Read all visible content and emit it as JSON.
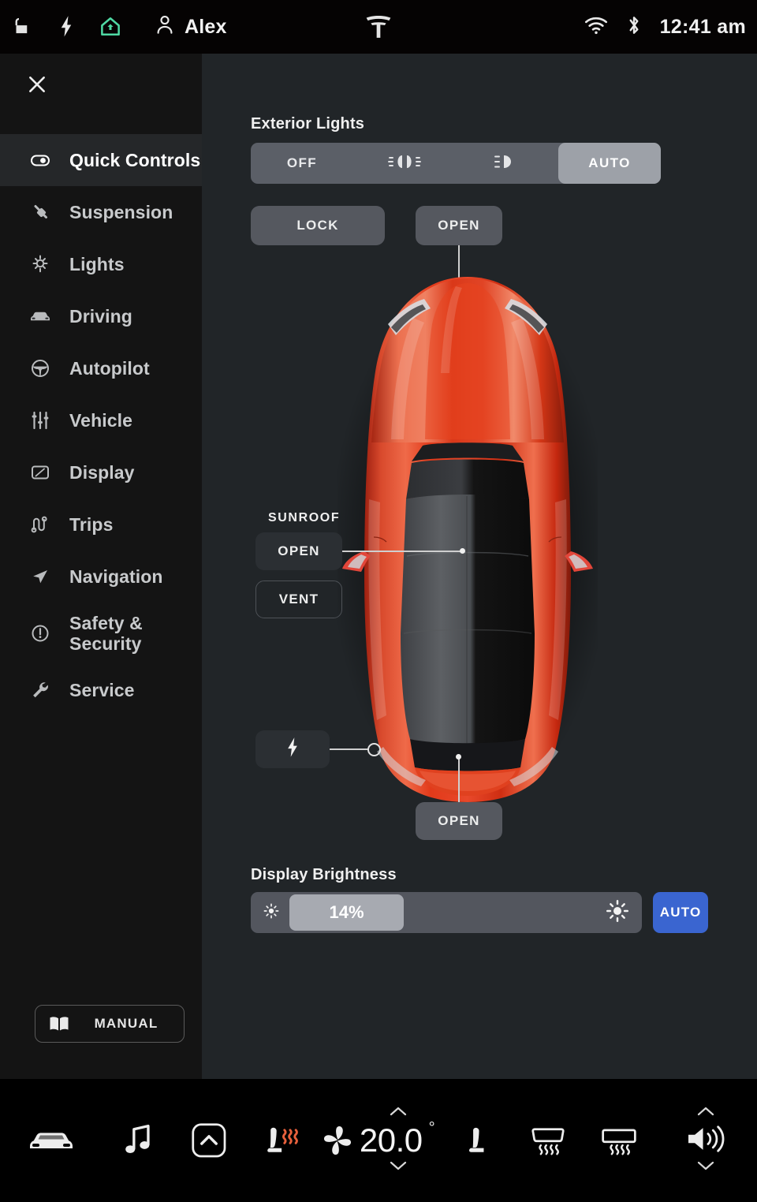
{
  "statusbar": {
    "icons": [
      "unlock-icon",
      "charge-bolt-icon",
      "home-icon",
      "person-icon"
    ],
    "profile_name": "Alex",
    "brand_logo": "tesla-logo-icon",
    "wifi": "wifi-icon",
    "bluetooth": "bluetooth-icon",
    "time": "12:41 am"
  },
  "sidebar": {
    "close": "close-icon",
    "items": [
      {
        "label": "Quick Controls",
        "icon": "toggle-icon",
        "active": true
      },
      {
        "label": "Suspension",
        "icon": "shock-absorber-icon",
        "active": false
      },
      {
        "label": "Lights",
        "icon": "sun-rays-icon",
        "active": false
      },
      {
        "label": "Driving",
        "icon": "car-front-icon",
        "active": false
      },
      {
        "label": "Autopilot",
        "icon": "steering-wheel-icon",
        "active": false
      },
      {
        "label": "Vehicle",
        "icon": "sliders-icon",
        "active": false
      },
      {
        "label": "Display",
        "icon": "screen-icon",
        "active": false
      },
      {
        "label": "Trips",
        "icon": "trip-meter-icon",
        "active": false
      },
      {
        "label": "Navigation",
        "icon": "navigation-arrow-icon",
        "active": false
      },
      {
        "label": "Safety & Security",
        "icon": "alert-circle-icon",
        "active": false
      },
      {
        "label": "Service",
        "icon": "wrench-icon",
        "active": false
      }
    ],
    "manual": {
      "label": "MANUAL",
      "icon": "book-icon"
    }
  },
  "panel": {
    "exterior_lights": {
      "title": "Exterior Lights",
      "options": [
        {
          "label": "OFF",
          "icon": null,
          "selected": false
        },
        {
          "label": "",
          "icon": "parking-lights-icon",
          "selected": false
        },
        {
          "label": "",
          "icon": "headlights-icon",
          "selected": false
        },
        {
          "label": "AUTO",
          "icon": null,
          "selected": true
        }
      ],
      "selected": "AUTO"
    },
    "lock_button": "LOCK",
    "frunk_button": "OPEN",
    "sunroof": {
      "title": "SUNROOF",
      "open": "OPEN",
      "vent": "VENT"
    },
    "charge_port": {
      "icon": "charge-bolt-icon"
    },
    "trunk_button": "OPEN",
    "brightness": {
      "title": "Display Brightness",
      "value": "14%",
      "percent": 14,
      "low_icon": "brightness-low-icon",
      "high_icon": "brightness-high-icon",
      "auto_label": "AUTO",
      "auto_color": "#3a65d0"
    },
    "vehicle_color": "#e03a20"
  },
  "bottombar": {
    "items": [
      {
        "name": "car-icon",
        "label": ""
      },
      {
        "name": "media-note-icon",
        "label": ""
      },
      {
        "name": "expand-up-icon",
        "label": ""
      },
      {
        "name": "seat-heater-left-icon",
        "label": ""
      },
      {
        "name": "fan-icon",
        "label": ""
      },
      {
        "name": "seat-icon",
        "label": ""
      },
      {
        "name": "rear-defrost-icon",
        "label": ""
      },
      {
        "name": "front-defrost-icon",
        "label": ""
      },
      {
        "name": "volume-icon",
        "label": ""
      }
    ],
    "temperature": "20.0",
    "degree_symbol": "°",
    "seat_heat_color": "#e8603c"
  }
}
